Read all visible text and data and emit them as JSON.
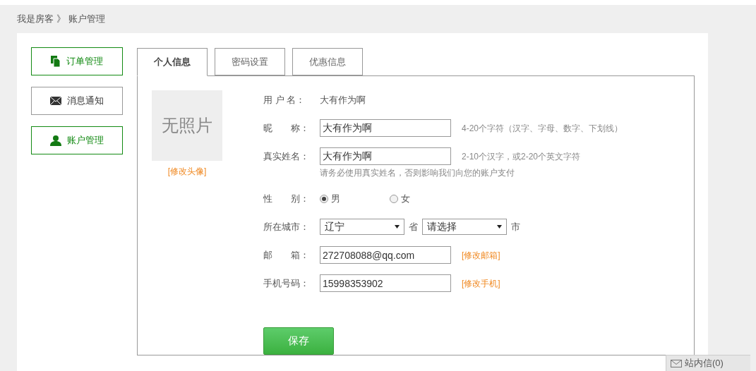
{
  "breadcrumb": {
    "items": [
      "我是房客",
      "账户管理"
    ],
    "separator": "》"
  },
  "sidebar": {
    "items": [
      {
        "label": "订单管理",
        "kind": "documents",
        "active": true
      },
      {
        "label": "消息通知",
        "kind": "mail",
        "active": false
      },
      {
        "label": "账户管理",
        "kind": "user",
        "active": true
      }
    ]
  },
  "tabs": [
    {
      "label": "个人信息",
      "selected": true
    },
    {
      "label": "密码设置",
      "selected": false
    },
    {
      "label": "优惠信息",
      "selected": false
    }
  ],
  "avatar": {
    "label": "无照片",
    "link": "[修改头像]"
  },
  "form": [
    {
      "kind": "text",
      "label": "用 户 名：",
      "value": "大有作为啊"
    },
    {
      "kind": "input",
      "label": "昵　　称：",
      "value": "大有作为啊",
      "hint": "4-20个字符（汉字、字母、数字、下划线）"
    },
    {
      "kind": "input",
      "label": "真实姓名：",
      "value": "大有作为啊",
      "hint": "2-10个汉字，或2-20个英文字符",
      "note": "请务必使用真实姓名，否则影响我们向您的账户支付"
    },
    {
      "kind": "radio",
      "label": "性　　别：",
      "options": [
        {
          "label": "男",
          "selected": true
        },
        {
          "label": "女",
          "selected": false
        }
      ]
    },
    {
      "kind": "select",
      "label": "所在城市：",
      "selects": [
        {
          "value": "辽宁",
          "suffix": "省"
        },
        {
          "value": "请选择",
          "suffix": "市"
        }
      ]
    },
    {
      "kind": "input",
      "label": "邮　　箱：",
      "value": "272708088@qq.com",
      "link": "[修改邮箱]"
    },
    {
      "kind": "input",
      "label": "手机号码：",
      "value": "15998353902",
      "link": "[修改手机]"
    }
  ],
  "save_button": "保存",
  "message_widget": {
    "label": "站内信(0)"
  }
}
